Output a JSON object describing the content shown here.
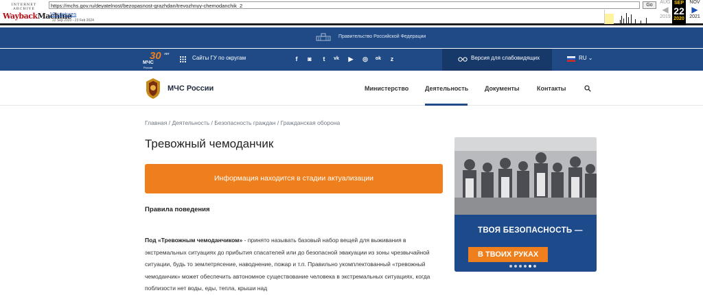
{
  "wayback": {
    "logo_top": "INTERNET ARCHIVE",
    "logo_main_1": "Wayback",
    "logo_main_2": "Machine",
    "url": "https://mchs.gov.ru/deyatelnost/bezopasnost-grazhdan/trevozhnyy-chemodanchik_2",
    "go_label": "Go",
    "captures": "19 captures",
    "date_range": "22 Sep 2020 - 23 Feb 2024",
    "prev_month": "AUG",
    "cur_month": "SEP",
    "next_month": "NOV",
    "cur_day": "22",
    "prev_year": "2019",
    "cur_year": "2020",
    "next_year": "2021"
  },
  "gov": {
    "title": "Правительство Российской Федерации"
  },
  "topbar": {
    "logo_number": "30",
    "logo_suffix": "лет",
    "logo_name": "МЧС",
    "logo_sub": "России",
    "okrug_link": "Сайты ГУ по округам",
    "social": [
      "f",
      "◙",
      "t",
      "vk",
      "▶",
      "◎",
      "ok",
      "z"
    ],
    "vision_label": "Версия для слабовидящих",
    "vision_icon": "glasses-icon",
    "lang": "RU"
  },
  "nav": {
    "brand": "МЧС России",
    "items": [
      "Министерство",
      "Деятельность",
      "Документы",
      "Контакты"
    ],
    "active_index": 1
  },
  "breadcrumbs": [
    "Главная",
    "Деятельность",
    "Безопасность граждан",
    "Гражданская оборона"
  ],
  "page": {
    "title": "Тревожный чемоданчик",
    "banner": "Информация находится в стадии актуализации",
    "subtitle": "Правила поведения",
    "para_bold": "Под «Тревожным чемоданчиком»",
    "para_rest": " - принято называть базовый набор вещей для выживания в экстремальных ситуациях до прибытия спасателей или до безопасной эвакуации из зоны чрезвычайной ситуации, будь то землетрясение, наводнение, пожар и т.п. Правильно укомплектованный «тревожный чемоданчик» может обеспечить автономное существование человека в экстремальных ситуациях, когда поблизости нет воды, еды, тепла, крыши над"
  },
  "promo": {
    "line1": "ТВОЯ БЕЗОПАСНОСТЬ —",
    "line2": "В ТВОИХ РУКАХ",
    "slides": 6,
    "active_slide": 5
  },
  "colors": {
    "brand_blue": "#1f4a86",
    "accent_orange": "#ee7f1c"
  }
}
